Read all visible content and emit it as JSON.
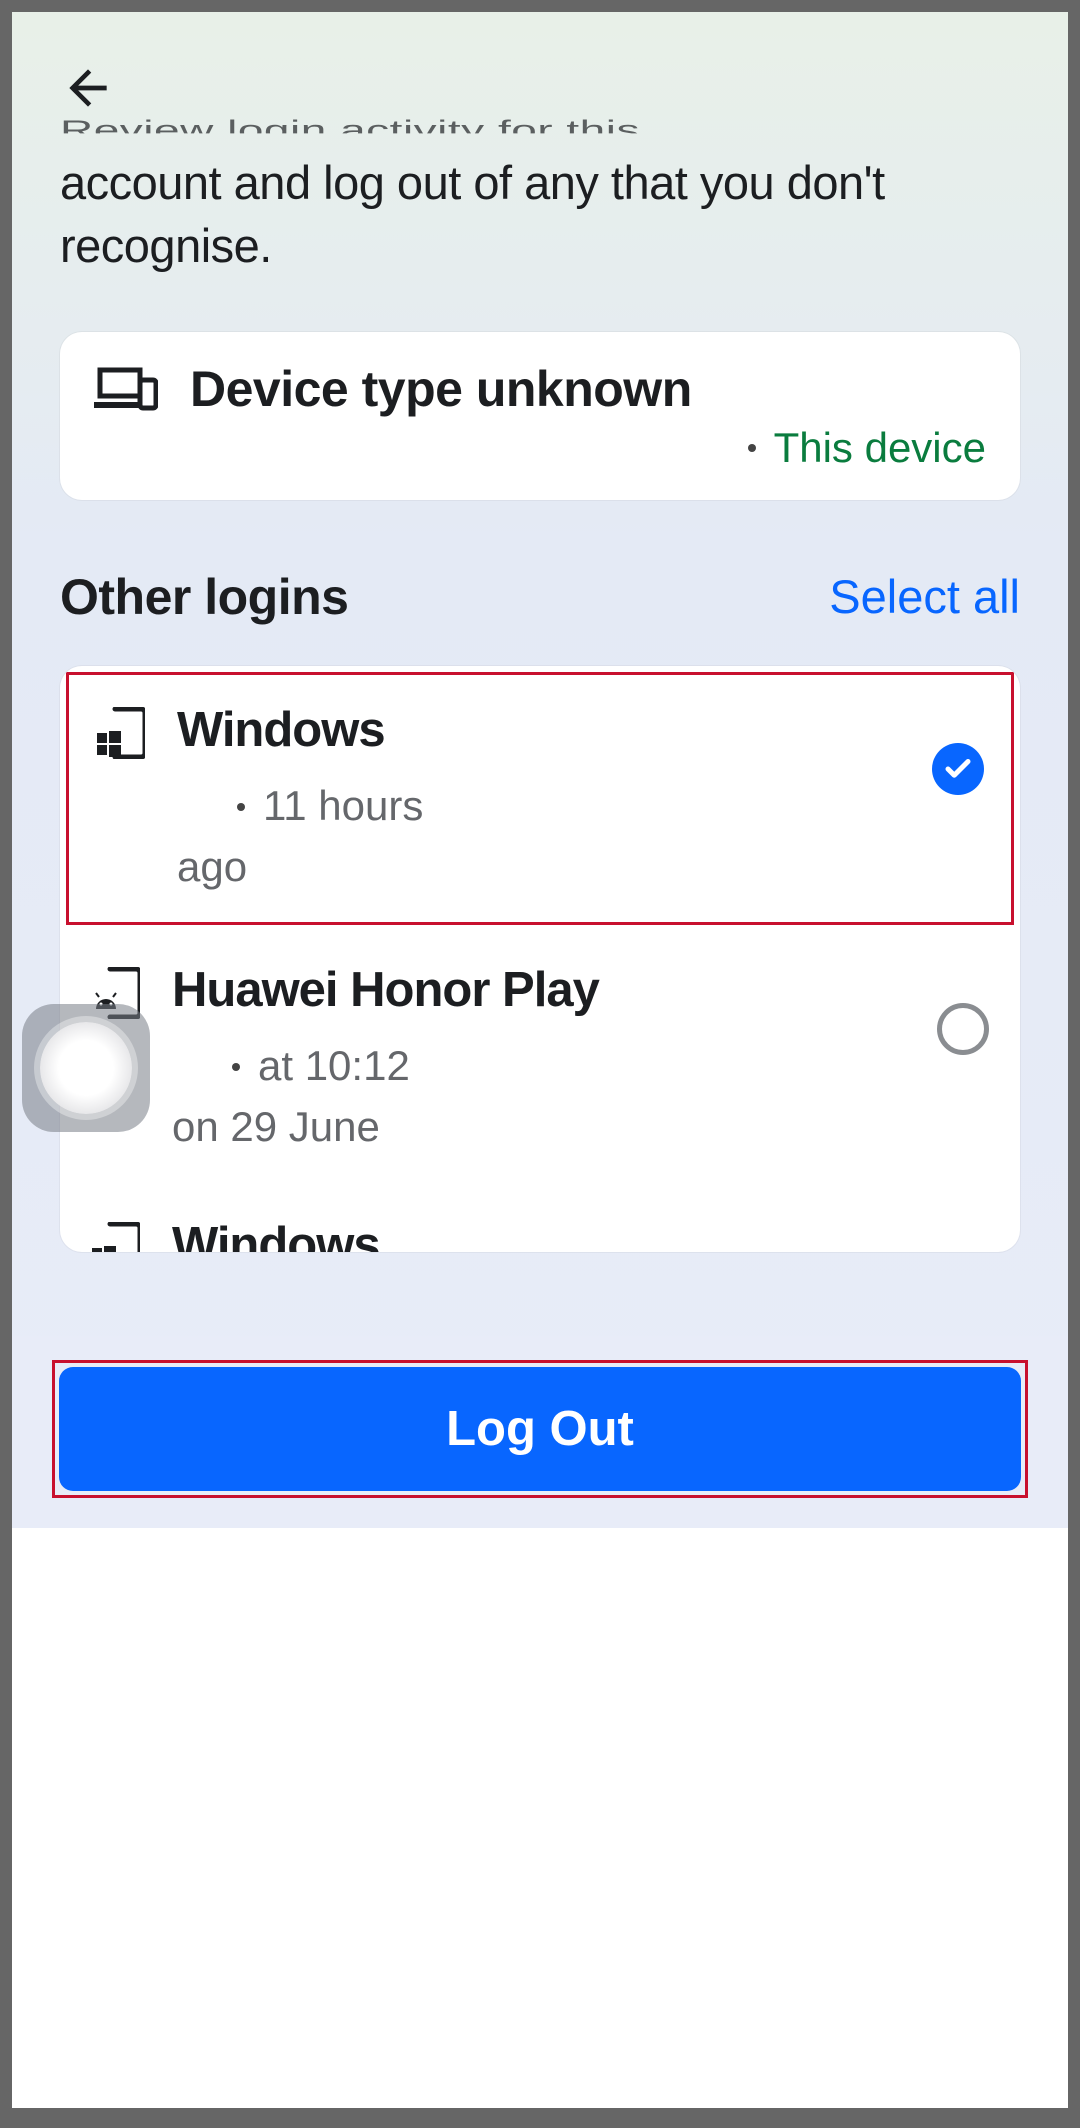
{
  "header": {
    "clipped_line": "Review login activity for this"
  },
  "description": "account and log out of any that you don't recognise.",
  "current_device": {
    "title": "Device type unknown",
    "badge": "This device"
  },
  "section": {
    "title": "Other logins",
    "select_all": "Select all"
  },
  "logins": [
    {
      "name": "Windows",
      "meta_first": "11 hours",
      "meta_second": "ago",
      "selected": true,
      "highlighted": true,
      "icon": "windows"
    },
    {
      "name": "Huawei Honor Play",
      "meta_first": "at 10:12",
      "meta_second": "on 29 June",
      "selected": false,
      "highlighted": false,
      "icon": "android"
    },
    {
      "name": "Windows",
      "meta_first": "",
      "meta_second": "",
      "selected": false,
      "highlighted": false,
      "icon": "windows",
      "partial": true
    }
  ],
  "footer": {
    "logout_label": "Log Out"
  }
}
